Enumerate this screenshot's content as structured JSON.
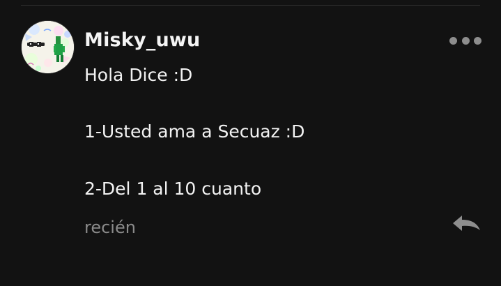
{
  "comment": {
    "username": "Misky_uwu",
    "lines": [
      "Hola Dice :D",
      "1-Usted ama a Secuaz :D",
      "2-Del 1 al 10 cuanto"
    ],
    "timestamp": "recién",
    "icons": {
      "more": "more-horizontal-icon",
      "reply": "reply-icon"
    }
  },
  "colors": {
    "background": "#121212",
    "text": "#f2f2f2",
    "muted": "#8b8b8b"
  }
}
